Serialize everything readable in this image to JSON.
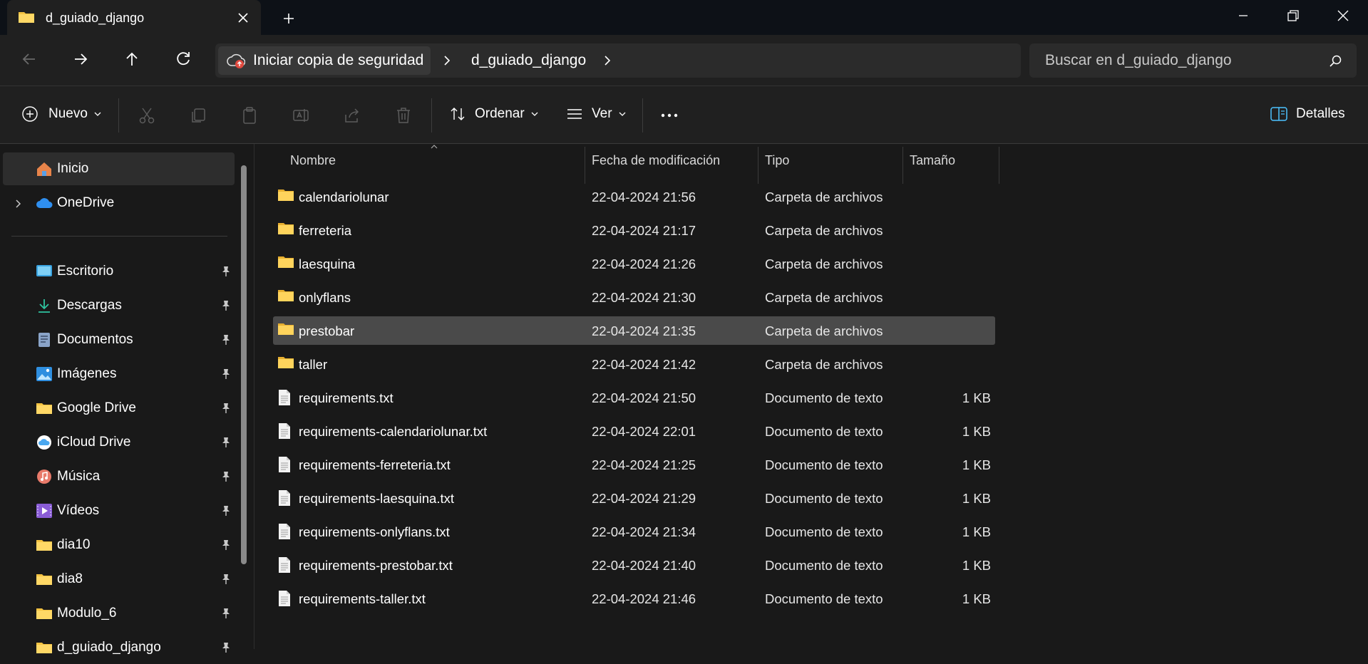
{
  "window": {
    "tab_title": "d_guiado_django",
    "tab_icon": "folder-icon",
    "minimize_icon": "minimize-icon",
    "maximize_icon": "restore-icon",
    "close_icon": "close-icon"
  },
  "address": {
    "backup_label": "Iniciar copia de seguridad",
    "crumb_folder": "d_guiado_django",
    "search_placeholder": "Buscar en d_guiado_django"
  },
  "toolbar": {
    "new_label": "Nuevo",
    "sort_label": "Ordenar",
    "view_label": "Ver",
    "details_label": "Detalles"
  },
  "sidebar": {
    "top_items": [
      {
        "label": "Inicio",
        "icon": "home-icon",
        "selected": true
      },
      {
        "label": "OneDrive",
        "icon": "cloud-icon",
        "selected": false
      }
    ],
    "pinned_items": [
      {
        "label": "Escritorio",
        "icon": "desktop-icon"
      },
      {
        "label": "Descargas",
        "icon": "download-icon"
      },
      {
        "label": "Documentos",
        "icon": "document-icon"
      },
      {
        "label": "Imágenes",
        "icon": "image-icon"
      },
      {
        "label": "Google Drive",
        "icon": "folder-icon"
      },
      {
        "label": "iCloud Drive",
        "icon": "icloud-icon"
      },
      {
        "label": "Música",
        "icon": "music-icon"
      },
      {
        "label": "Vídeos",
        "icon": "video-icon"
      },
      {
        "label": "dia10",
        "icon": "folder-icon"
      },
      {
        "label": "dia8",
        "icon": "folder-icon"
      },
      {
        "label": "Modulo_6",
        "icon": "folder-icon"
      },
      {
        "label": "d_guiado_django",
        "icon": "folder-icon"
      }
    ]
  },
  "columns": {
    "name": "Nombre",
    "date": "Fecha de modificación",
    "type": "Tipo",
    "size": "Tamaño"
  },
  "files": [
    {
      "name": "calendariolunar",
      "date": "22-04-2024 21:56",
      "type": "Carpeta de archivos",
      "size": "",
      "kind": "folder"
    },
    {
      "name": "ferreteria",
      "date": "22-04-2024 21:17",
      "type": "Carpeta de archivos",
      "size": "",
      "kind": "folder"
    },
    {
      "name": "laesquina",
      "date": "22-04-2024 21:26",
      "type": "Carpeta de archivos",
      "size": "",
      "kind": "folder"
    },
    {
      "name": "onlyflans",
      "date": "22-04-2024 21:30",
      "type": "Carpeta de archivos",
      "size": "",
      "kind": "folder"
    },
    {
      "name": "prestobar",
      "date": "22-04-2024 21:35",
      "type": "Carpeta de archivos",
      "size": "",
      "kind": "folder",
      "selected": true
    },
    {
      "name": "taller",
      "date": "22-04-2024 21:42",
      "type": "Carpeta de archivos",
      "size": "",
      "kind": "folder"
    },
    {
      "name": "requirements.txt",
      "date": "22-04-2024 21:50",
      "type": "Documento de texto",
      "size": "1 KB",
      "kind": "text"
    },
    {
      "name": "requirements-calendariolunar.txt",
      "date": "22-04-2024 22:01",
      "type": "Documento de texto",
      "size": "1 KB",
      "kind": "text"
    },
    {
      "name": "requirements-ferreteria.txt",
      "date": "22-04-2024 21:25",
      "type": "Documento de texto",
      "size": "1 KB",
      "kind": "text"
    },
    {
      "name": "requirements-laesquina.txt",
      "date": "22-04-2024 21:29",
      "type": "Documento de texto",
      "size": "1 KB",
      "kind": "text"
    },
    {
      "name": "requirements-onlyflans.txt",
      "date": "22-04-2024 21:34",
      "type": "Documento de texto",
      "size": "1 KB",
      "kind": "text"
    },
    {
      "name": "requirements-prestobar.txt",
      "date": "22-04-2024 21:40",
      "type": "Documento de texto",
      "size": "1 KB",
      "kind": "text"
    },
    {
      "name": "requirements-taller.txt",
      "date": "22-04-2024 21:46",
      "type": "Documento de texto",
      "size": "1 KB",
      "kind": "text"
    }
  ],
  "colors": {
    "folder": "#f5c342",
    "accent": "#4cc2ff",
    "selected_row": "#4a4a4a"
  }
}
